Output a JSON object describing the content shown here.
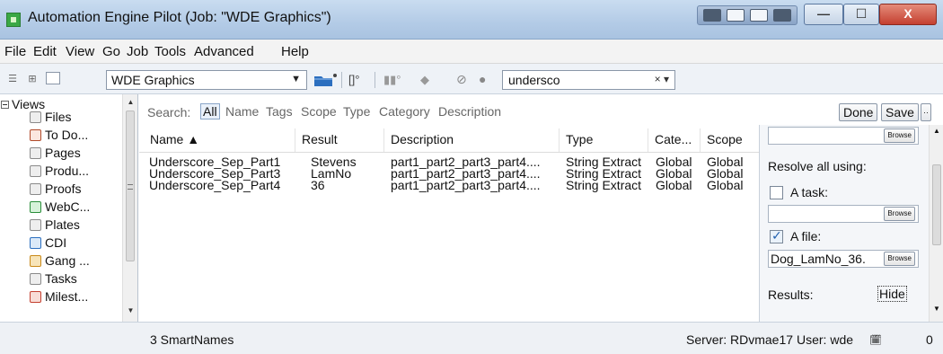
{
  "window": {
    "title": "Automation Engine Pilot (Job: \"WDE Graphics\")",
    "minimize": "—",
    "maximize": "☐",
    "close": "X"
  },
  "menu": [
    "File",
    "Edit",
    "View",
    "Go",
    "Job",
    "Tools",
    "Advanced",
    "Help"
  ],
  "toolbar": {
    "job": "WDE Graphics",
    "filter_value": "undersco",
    "clear_label": "× ▾"
  },
  "sidebar": {
    "views_label": "Views",
    "items": [
      {
        "label": "Files",
        "icon": "file-icon"
      },
      {
        "label": "To Do...",
        "icon": "todo-icon"
      },
      {
        "label": "Pages",
        "icon": "pages-icon"
      },
      {
        "label": "Produ...",
        "icon": "products-icon"
      },
      {
        "label": "Proofs",
        "icon": "proofs-icon"
      },
      {
        "label": "WebC...",
        "icon": "webcenter-icon"
      },
      {
        "label": "Plates",
        "icon": "plates-icon"
      },
      {
        "label": "CDI",
        "icon": "cdi-icon"
      },
      {
        "label": "Gang ...",
        "icon": "gang-icon"
      },
      {
        "label": "Tasks",
        "icon": "tasks-icon"
      },
      {
        "label": "Milest...",
        "icon": "milestones-icon"
      }
    ]
  },
  "search": {
    "label": "Search:",
    "filters": [
      "All",
      "Name",
      "Tags",
      "Scope",
      "Type",
      "Category",
      "Description"
    ],
    "active_filter": "All",
    "done_label": "Done",
    "save_label": "Save",
    "more_label": "··"
  },
  "table": {
    "columns": [
      "Name ▲",
      "Result",
      "Description",
      "Type",
      "Cate...",
      "Scope"
    ],
    "rows": [
      {
        "name": "Underscore_Sep_Part1",
        "result": "Stevens",
        "description": "part1_part2_part3_part4....",
        "type": "String Extract",
        "category": "Global",
        "scope": "Global"
      },
      {
        "name": "Underscore_Sep_Part3",
        "result": "LamNo",
        "description": "part1_part2_part3_part4....",
        "type": "String Extract",
        "category": "Global",
        "scope": "Global"
      },
      {
        "name": "Underscore_Sep_Part4",
        "result": "36",
        "description": "part1_part2_part3_part4....",
        "type": "String Extract",
        "category": "Global",
        "scope": "Global"
      }
    ]
  },
  "resolve_panel": {
    "browse_label": "Browse",
    "resolve_label": "Resolve all using:",
    "task_label": "A task:",
    "task_checked": false,
    "file_label": "A file:",
    "file_checked": true,
    "file_value": "Dog_LamNo_36.",
    "results_label": "Results:",
    "hide_label": "Hide"
  },
  "status": {
    "count": "3 SmartNames",
    "server": "Server: RDvmae17",
    "user": "User: wde",
    "notifications": "0"
  },
  "colors": {
    "titlebar": "#b3cbe6",
    "accent": "#1f5fae"
  }
}
